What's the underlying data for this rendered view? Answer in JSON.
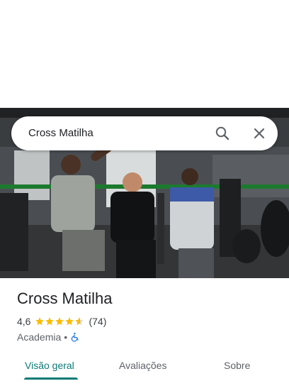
{
  "search": {
    "query": "Cross Matilha",
    "search_icon": "search-icon",
    "close_icon": "close-icon"
  },
  "place": {
    "name": "Cross Matilha",
    "rating": "4,6",
    "rating_value": 4.6,
    "reviews_count": "(74)",
    "category": "Academia",
    "separator": "•",
    "accessibility_icon": "wheelchair-icon"
  },
  "tabs": [
    {
      "label": "Visão geral",
      "active": true
    },
    {
      "label": "Avaliações",
      "active": false
    },
    {
      "label": "Sobre",
      "active": false
    }
  ],
  "colors": {
    "accent": "#0b7a75",
    "star": "#fbbc04",
    "wheelchair": "#1a73e8"
  }
}
